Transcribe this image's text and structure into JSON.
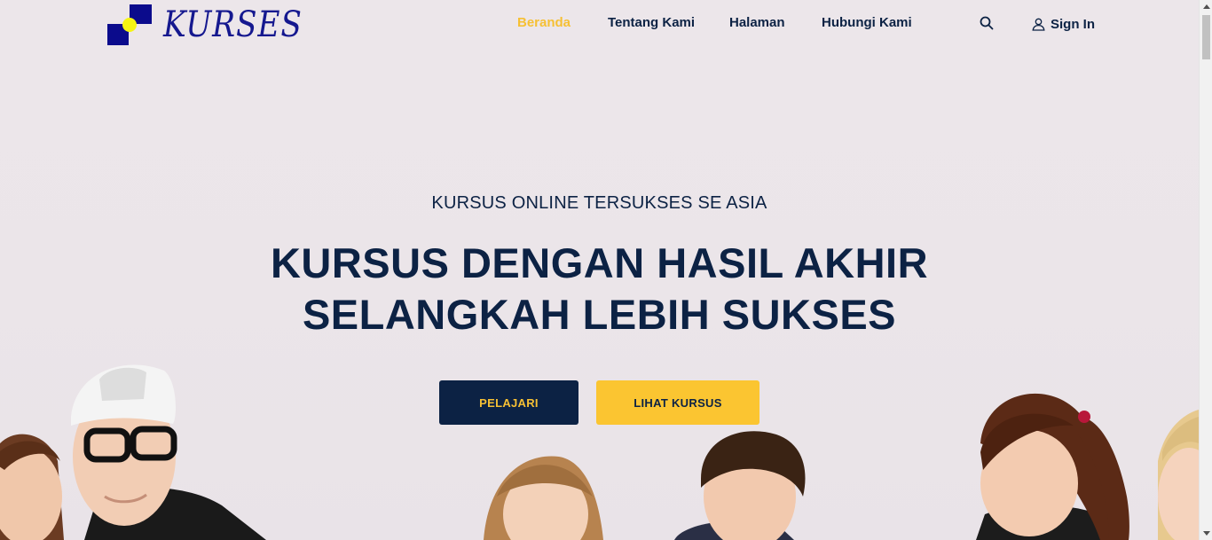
{
  "brand": {
    "name": "KURSES",
    "logo_icon": "logo-icon"
  },
  "nav": {
    "items": [
      {
        "label": "Beranda",
        "active": true
      },
      {
        "label": "Tentang Kami",
        "active": false
      },
      {
        "label": "Halaman",
        "active": false
      },
      {
        "label": "Hubungi Kami",
        "active": false
      }
    ],
    "search_icon": "search-icon",
    "signin_icon": "user-icon",
    "signin_label": "Sign In"
  },
  "hero": {
    "subtitle": "KURSUS ONLINE TERSUKSES SE ASIA",
    "headline": "KURSUS DENGAN HASIL AKHIR SELANGKAH LEBIH SUKSES",
    "primary_button": "PELAJARI",
    "secondary_button": "LIHAT KURSUS"
  },
  "colors": {
    "navy": "#0c2244",
    "accent_yellow": "#fbc531",
    "active_link": "#f6c034",
    "logo_blue": "#15188f",
    "background": "#ebe6e9"
  }
}
